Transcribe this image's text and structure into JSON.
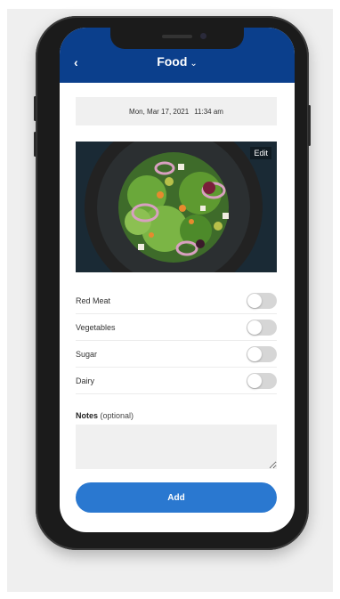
{
  "header": {
    "title": "Food",
    "title_chevron": "⌄",
    "back_icon": "‹"
  },
  "entry": {
    "date": "Mon, Mar 17, 2021",
    "time": "11:34 am"
  },
  "image": {
    "edit_label": "Edit"
  },
  "toggles": [
    {
      "label": "Red Meat",
      "on": false
    },
    {
      "label": "Vegetables",
      "on": false
    },
    {
      "label": "Sugar",
      "on": false
    },
    {
      "label": "Dairy",
      "on": false
    }
  ],
  "notes": {
    "label": "Notes",
    "optional": "(optional)",
    "value": ""
  },
  "actions": {
    "add_label": "Add"
  },
  "colors": {
    "header": "#0b3f8c",
    "button": "#2a78d0",
    "toggle_off": "#d6d6d6"
  }
}
